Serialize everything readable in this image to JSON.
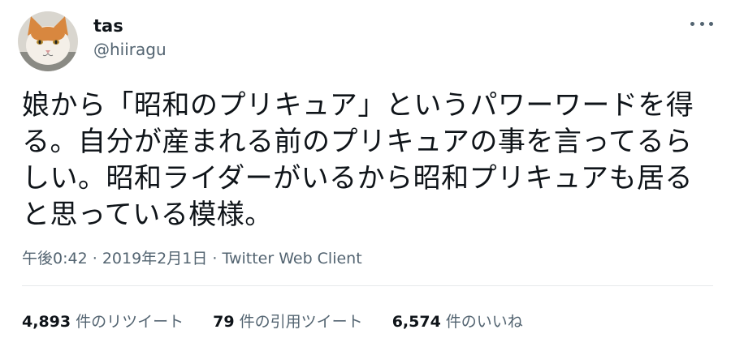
{
  "user": {
    "display_name": "tas",
    "handle": "@hiiragu",
    "avatar_icon": "cat-avatar"
  },
  "tweet": {
    "text": "娘から「昭和のプリキュア」というパワーワードを得る。自分が産まれる前のプリキュアの事を言ってるらしい。昭和ライダーがいるから昭和プリキュアも居ると思っている模様。",
    "time": "午後0:42",
    "date": "2019年2月1日",
    "source": "Twitter Web Client",
    "separator": "·"
  },
  "stats": [
    {
      "count": "4,893",
      "label": "件のリツイート"
    },
    {
      "count": "79",
      "label": "件の引用ツイート"
    },
    {
      "count": "6,574",
      "label": "件のいいね"
    }
  ],
  "colors": {
    "text": "#0f1419",
    "secondary": "#536471",
    "divider": "#e7e9eb"
  }
}
